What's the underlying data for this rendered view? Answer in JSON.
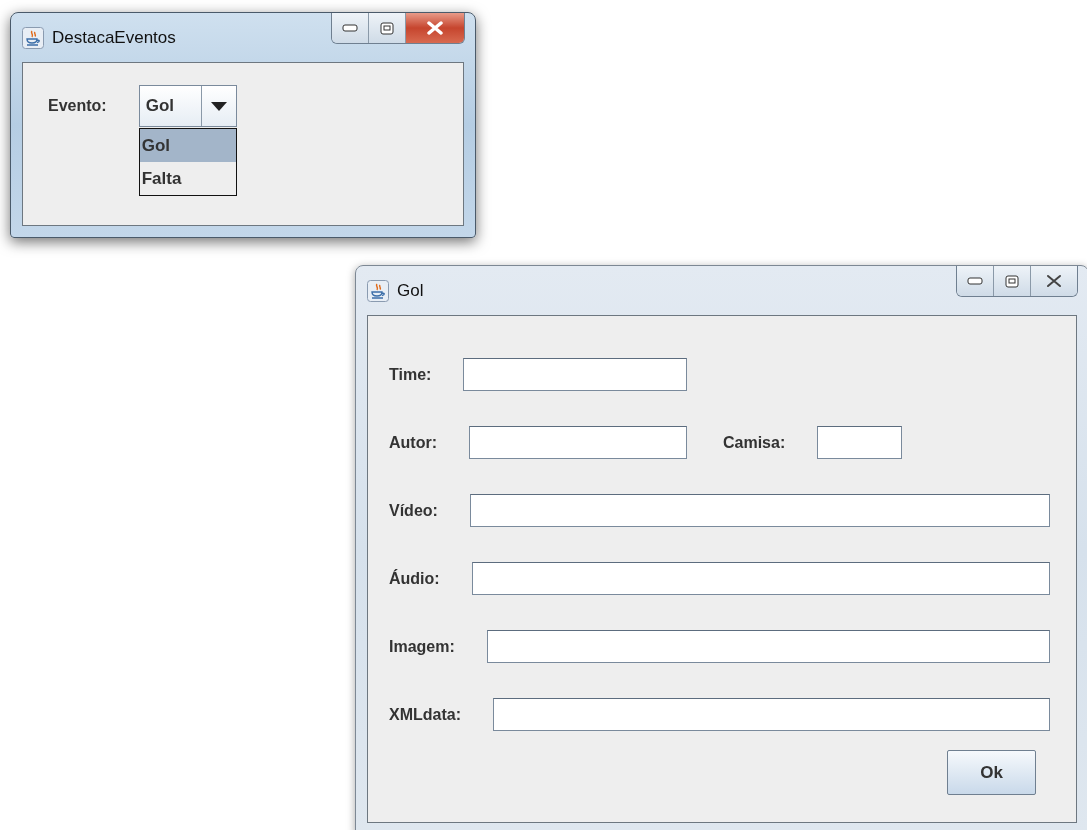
{
  "main_window": {
    "title": "DestacaEventos",
    "active": true,
    "evento_label": "Evento:",
    "combo": {
      "value": "Gol",
      "expanded": true,
      "options": [
        {
          "label": "Gol",
          "selected": true
        },
        {
          "label": "Falta",
          "selected": false
        }
      ]
    }
  },
  "gol_window": {
    "title": "Gol",
    "active": false,
    "rows": [
      {
        "fields": [
          {
            "label": "Time:"
          }
        ]
      },
      {
        "fields": [
          {
            "label": "Autor:"
          },
          {
            "label": "Camisa:"
          }
        ]
      },
      {
        "fields": [
          {
            "label": "Vídeo:"
          }
        ]
      },
      {
        "fields": [
          {
            "label": "Áudio:"
          }
        ]
      },
      {
        "fields": [
          {
            "label": "Imagem:"
          }
        ]
      },
      {
        "fields": [
          {
            "label": "XMLdata:"
          }
        ]
      }
    ],
    "ok_button": "Ok"
  }
}
